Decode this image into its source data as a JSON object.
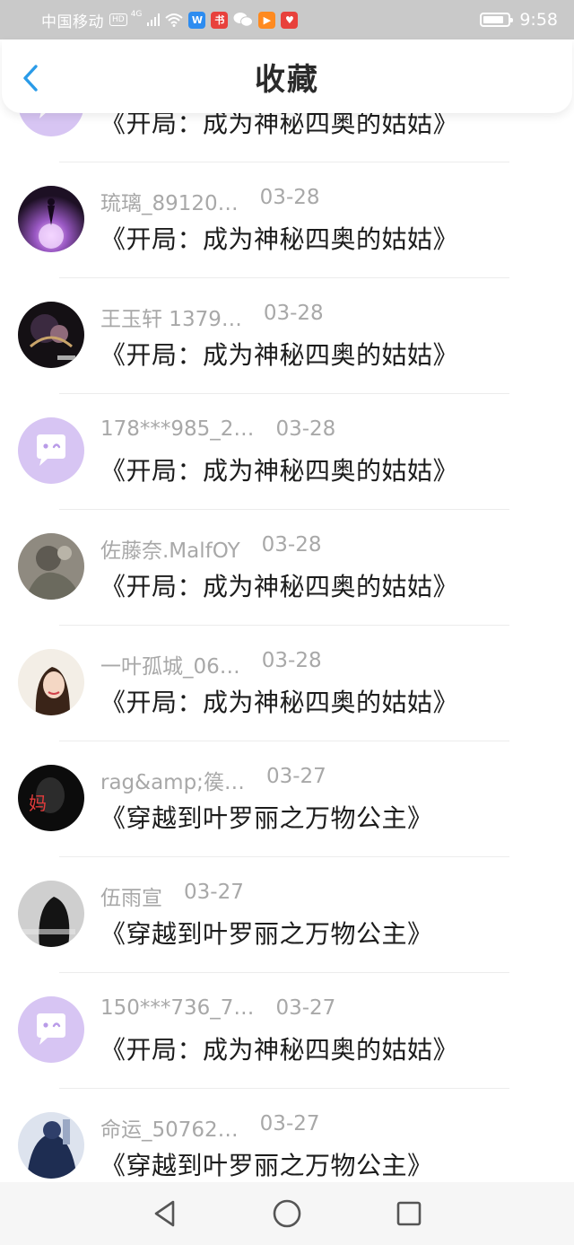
{
  "status_bar": {
    "carrier": "中国移动",
    "hd_badge": "HD",
    "network": "4G",
    "time": "9:58",
    "battery_level": 0.85,
    "app_icons": [
      "wifi-app-icon",
      "red-book-icon",
      "wechat-icon",
      "orange-video-icon",
      "heart-app-icon"
    ]
  },
  "header": {
    "title": "收藏",
    "back_icon": "chevron-left-icon"
  },
  "items": [
    {
      "user": "",
      "date": "",
      "title": "《开局：成为神秘四奥的姑姑》",
      "avatar": "default"
    },
    {
      "user": "琉璃_89120…",
      "date": "03-28",
      "title": "《开局：成为神秘四奥的姑姑》",
      "avatar": "photo-purple"
    },
    {
      "user": "王玉轩 1379…",
      "date": "03-28",
      "title": "《开局：成为神秘四奥的姑姑》",
      "avatar": "photo-dark"
    },
    {
      "user": "178***985_2…",
      "date": "03-28",
      "title": "《开局：成为神秘四奥的姑姑》",
      "avatar": "default"
    },
    {
      "user": "佐藤奈.MalfOY",
      "date": "03-28",
      "title": "《开局：成为神秘四奥的姑姑》",
      "avatar": "photo-grey"
    },
    {
      "user": "一叶孤城_06…",
      "date": "03-28",
      "title": "《开局：成为神秘四奥的姑姑》",
      "avatar": "photo-portrait"
    },
    {
      "user": "rag&amp;篌…",
      "date": "03-27",
      "title": "《穿越到叶罗丽之万物公主》",
      "avatar": "photo-black"
    },
    {
      "user": "伍雨宣",
      "date": "03-27",
      "title": "《穿越到叶罗丽之万物公主》",
      "avatar": "photo-mono"
    },
    {
      "user": "150***736_7…",
      "date": "03-27",
      "title": "《开局：成为神秘四奥的姑姑》",
      "avatar": "default"
    },
    {
      "user": "命运_50762…",
      "date": "03-27",
      "title": "《穿越到叶罗丽之万物公主》",
      "avatar": "photo-blue"
    }
  ],
  "nav_bar": {
    "back": "triangle-back-icon",
    "home": "circle-home-icon",
    "recents": "square-recents-icon"
  }
}
